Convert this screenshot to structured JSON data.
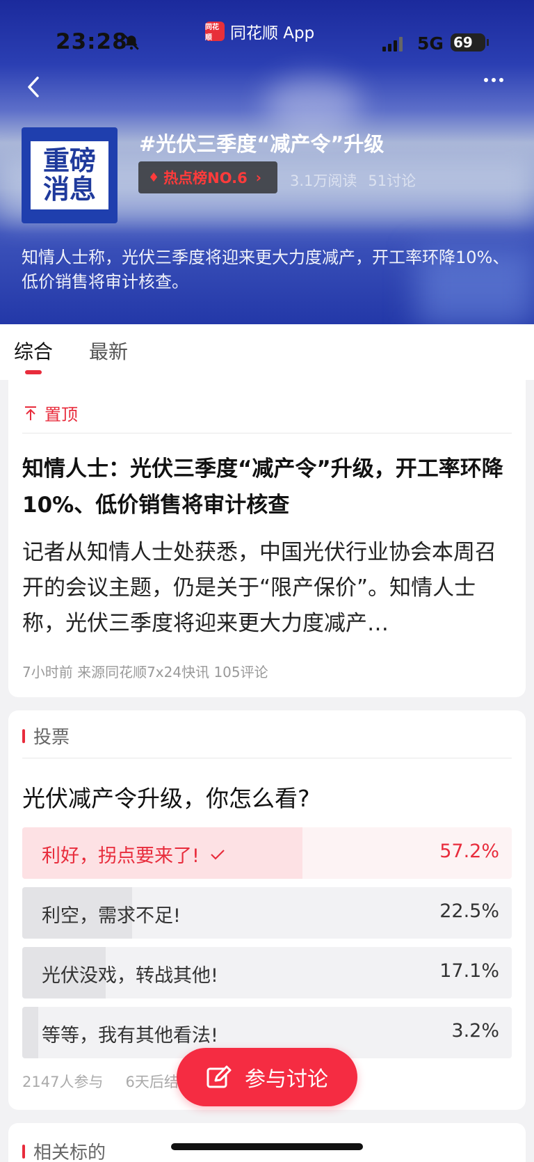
{
  "status_bar": {
    "time": "23:28",
    "app_name": "同花顺 App",
    "network": "5G",
    "battery": "69",
    "app_logo_text": "同花顺"
  },
  "header": {
    "cover_line1": "重磅",
    "cover_line2": "消息",
    "topic_title": "#光伏三季度“减产令”升级",
    "hot_rank": "热点榜NO.6",
    "reads": "3.1万阅读",
    "discussions": "51讨论",
    "description": "知情人士称，光伏三季度将迎来更大力度减产，开工率环降10%、低价销售将审计核查。"
  },
  "tabs": [
    {
      "label": "综合"
    },
    {
      "label": "最新"
    }
  ],
  "pinned": {
    "pin_label": "置顶",
    "title": "知情人士：光伏三季度“减产令”升级，开工率环降10%、低价销售将审计核查",
    "summary": "记者从知情人士处获悉，中国光伏行业协会本周召开的会议主题，仍是关于“限产保价”。知情人士称，光伏三季度将迎来更大力度减产…",
    "meta": "7小时前 来源同花顺7x24快讯 105评论"
  },
  "vote": {
    "section_label": "投票",
    "question": "光伏减产令升级，你怎么看?",
    "options": [
      {
        "label": "利好，拐点要来了!",
        "percent": "57.2%",
        "value": 0.572,
        "selected": true
      },
      {
        "label": "利空，需求不足!",
        "percent": "22.5%",
        "value": 0.225,
        "selected": false
      },
      {
        "label": "光伏没戏，转战其他!",
        "percent": "17.1%",
        "value": 0.171,
        "selected": false
      },
      {
        "label": "等等，我有其他看法!",
        "percent": "3.2%",
        "value": 0.032,
        "selected": false
      }
    ],
    "participants": "2147人参与",
    "ends": "6天后结束"
  },
  "discuss_button": "参与讨论",
  "related": {
    "section_label": "相关标的"
  },
  "colors": {
    "accent": "#e82c3c",
    "button": "#f52c42",
    "hero": "#2338a8"
  }
}
